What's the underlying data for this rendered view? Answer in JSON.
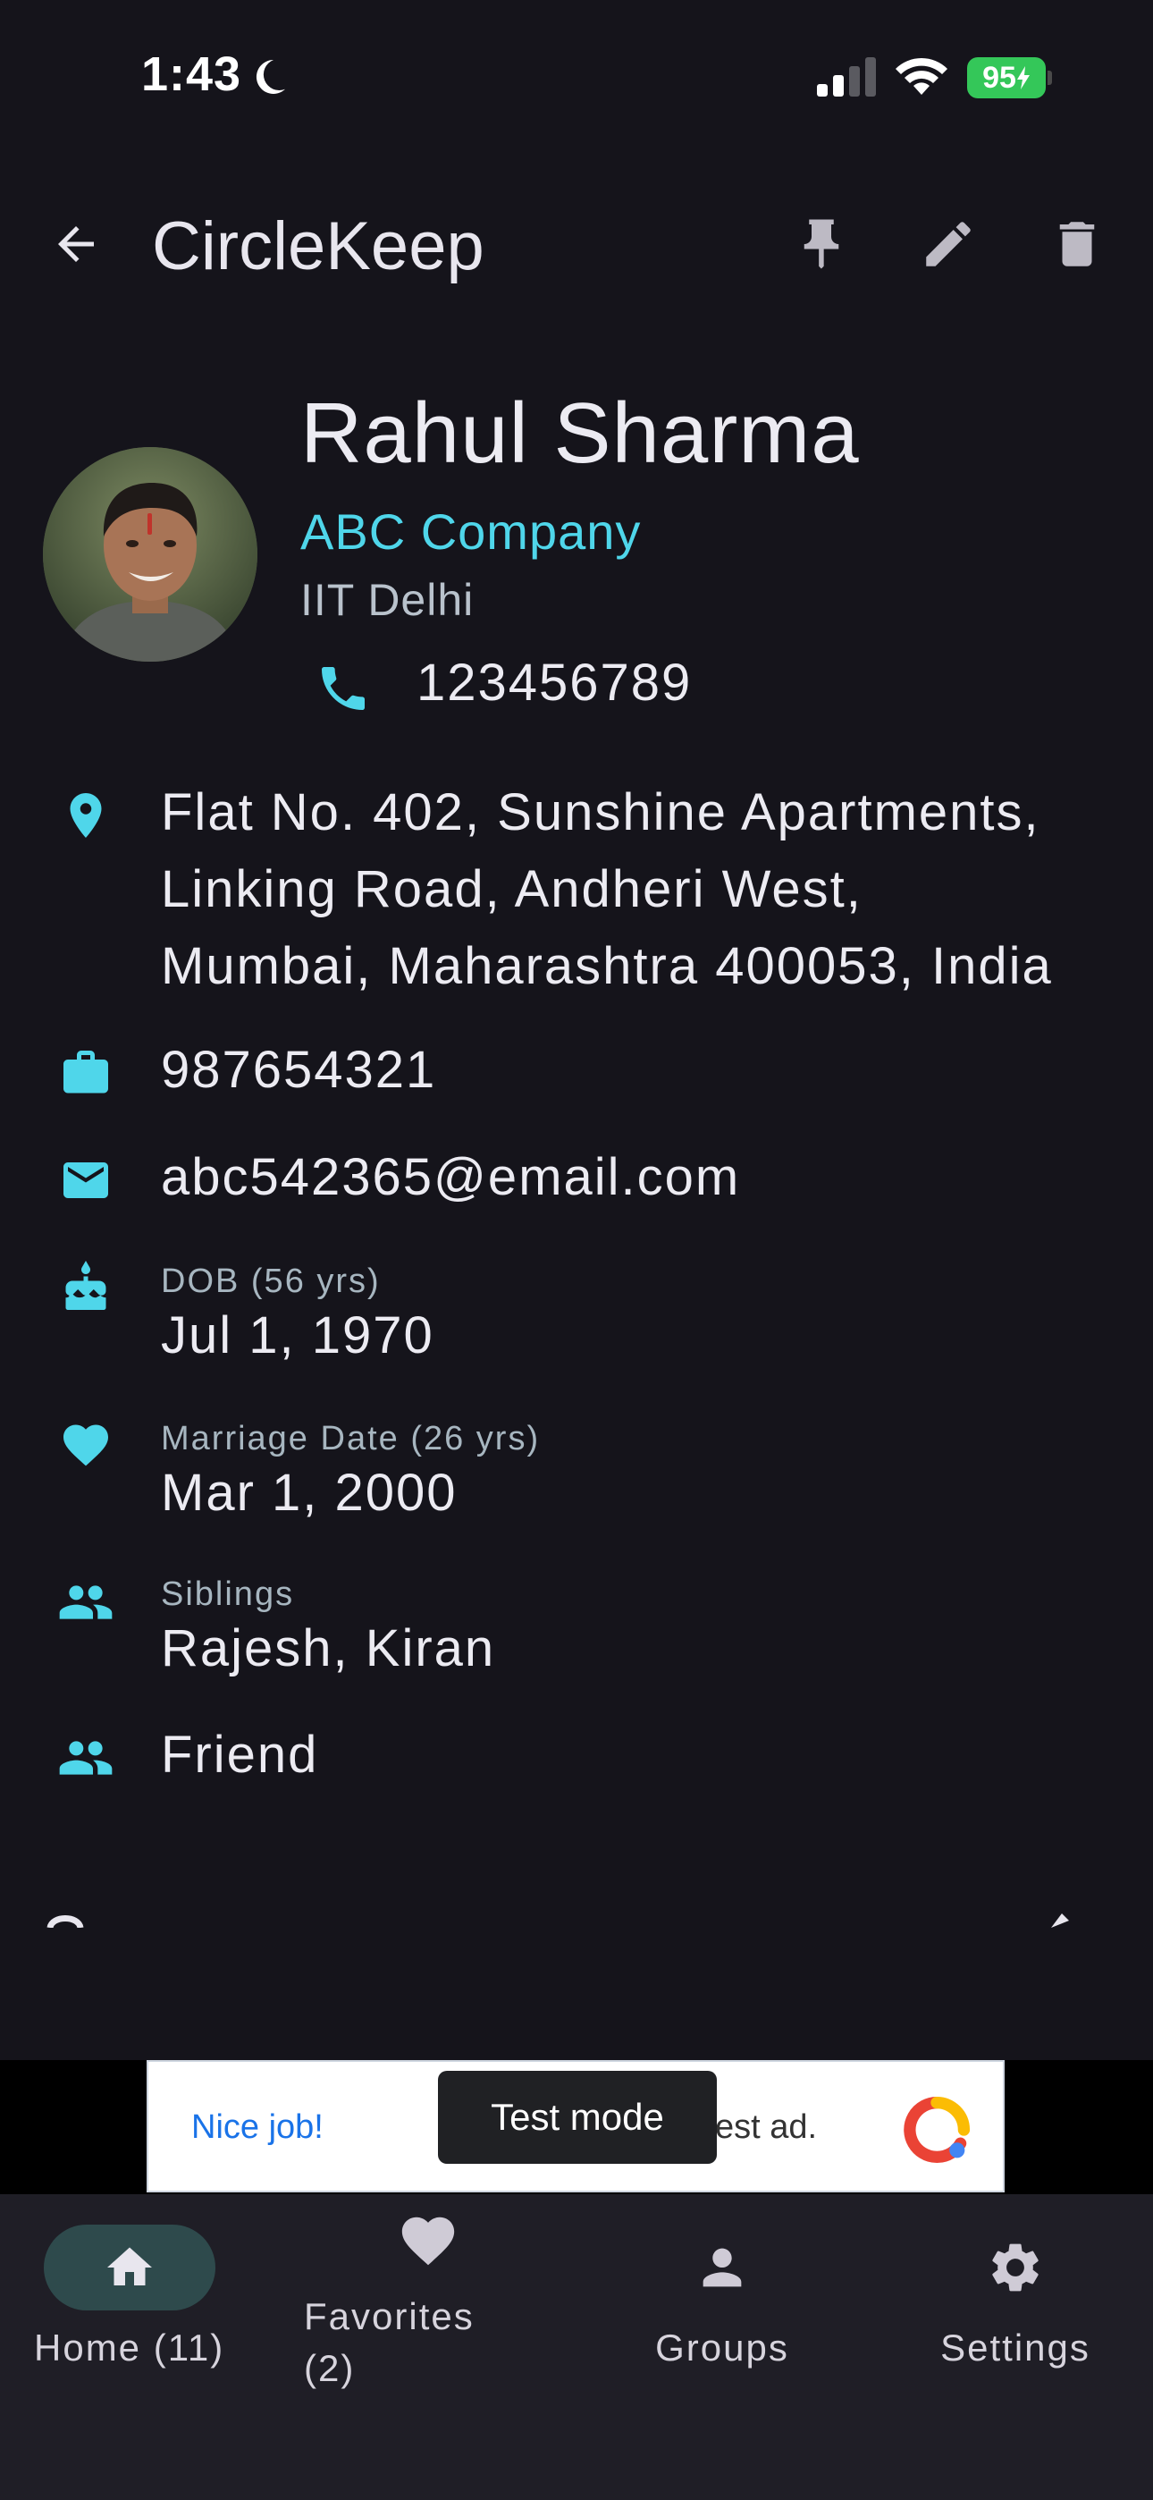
{
  "status_bar": {
    "time": "1:43",
    "battery": "95"
  },
  "app_bar": {
    "title": "CircleKeep"
  },
  "contact": {
    "name": "Rahul Sharma",
    "company": "ABC Company",
    "college": "IIT Delhi",
    "phone": "123456789",
    "address_lines": [
      "Flat No. 402, Sunshine Apartments,",
      "Linking Road, Andheri West,",
      "Mumbai, Maharashtra 400053, India"
    ],
    "work_phone": "987654321",
    "email": "abc542365@email.com",
    "dob_label": "DOB (56 yrs)",
    "dob": "Jul 1, 1970",
    "marriage_label": "Marriage Date (26 yrs)",
    "marriage_date": "Mar 1, 2000",
    "siblings_label": "Siblings",
    "siblings": "Rajesh, Kiran",
    "relationship": "Friend"
  },
  "ad": {
    "left_text": "Nice job!",
    "right_text": "est ad.",
    "toast": "Test mode"
  },
  "nav": {
    "home_label": "Home (11)",
    "favorites_label_line1": "Favorites",
    "favorites_label_line2": "(2)",
    "groups_label": "Groups",
    "settings_label": "Settings"
  },
  "colors": {
    "background": "#15141b",
    "accent": "#4fd6ea",
    "nav_background": "#1f1e26",
    "nav_active_pill": "#2e4a4c",
    "battery": "#34c759"
  }
}
